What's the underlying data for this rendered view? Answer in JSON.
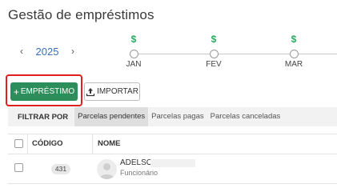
{
  "page": {
    "title": "Gestão de empréstimos"
  },
  "year_nav": {
    "year": "2025",
    "prev": "‹",
    "next": "›"
  },
  "timeline": {
    "marker": "$",
    "months": [
      {
        "label": "JAN"
      },
      {
        "label": "FEV"
      },
      {
        "label": "MAR"
      }
    ]
  },
  "actions": {
    "add_label": "EMPRÉSTIMO",
    "add_prefix": "+",
    "import_label": "IMPORTAR"
  },
  "filter": {
    "label": "FILTRAR POR",
    "tabs": [
      {
        "label": "Parcelas pendentes",
        "active": true
      },
      {
        "label": "Parcelas pagas",
        "active": false
      },
      {
        "label": "Parcelas canceladas",
        "active": false
      }
    ]
  },
  "table": {
    "columns": {
      "code": "CÓDIGO",
      "name": "NOME"
    },
    "rows": [
      {
        "code": "431",
        "name": "ADELSO",
        "role": "Funcionário"
      }
    ]
  },
  "colors": {
    "primary": "#2d8e5b",
    "marker": "#27a85f",
    "year": "#3a6fb5",
    "highlight": "#e02020"
  }
}
